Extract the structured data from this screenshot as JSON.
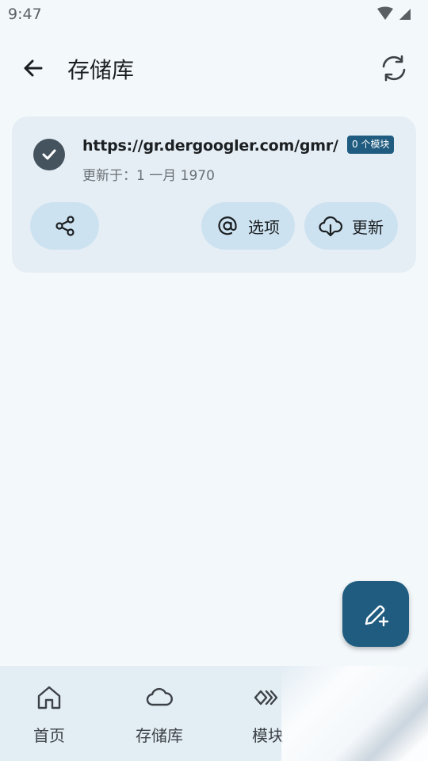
{
  "status_bar": {
    "time": "9:47",
    "icons": [
      "wifi-icon",
      "cellular-icon"
    ]
  },
  "app_bar": {
    "title": "存储库",
    "back_icon": "arrow-left-icon",
    "sync_icon": "sync-icon"
  },
  "repo_card": {
    "url": "https://gr.dergoogler.com/gmr/",
    "module_badge": "0 个模块",
    "updated": "更新于：1 一月 1970",
    "share_icon": "share-icon",
    "options_label": "选项",
    "options_icon": "at-icon",
    "update_label": "更新",
    "update_icon": "cloud-download-icon"
  },
  "fab": {
    "icon": "edit-plus-icon"
  },
  "bottom_nav": {
    "items": [
      {
        "label": "首页",
        "icon": "home-icon"
      },
      {
        "label": "存储库",
        "icon": "cloud-icon"
      },
      {
        "label": "模块",
        "icon": "modules-icon"
      }
    ]
  },
  "colors": {
    "background": "#f3f8fb",
    "card": "#e5eef5",
    "pill": "#cde2f0",
    "accent": "#1f5c80",
    "nav": "#e3edf4"
  }
}
